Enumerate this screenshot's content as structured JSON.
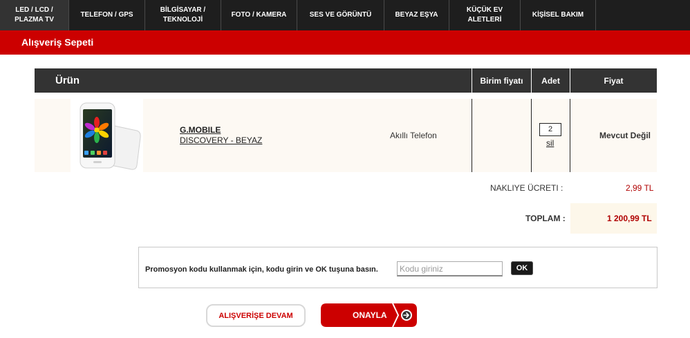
{
  "nav": {
    "items": [
      {
        "label": "LED / LCD /\nPLAZMA TV",
        "width": 100
      },
      {
        "label": "TELEFON / GPS",
        "width": 110
      },
      {
        "label": "BİLGİSAYAR /\nTEKNOLOJİ",
        "width": 110
      },
      {
        "label": "FOTO / KAMERA",
        "width": 110
      },
      {
        "label": "SES VE GÖRÜNTÜ",
        "width": 126
      },
      {
        "label": "BEYAZ EŞYA",
        "width": 94
      },
      {
        "label": "KÜÇÜK EV\nALETLERİ",
        "width": 103
      },
      {
        "label": "KİŞİSEL BAKIM",
        "width": 109
      }
    ]
  },
  "page": {
    "title": "Alışveriş Sepeti"
  },
  "cart": {
    "headers": {
      "product": "Ürün",
      "unit_price": "Birim fiyatı",
      "quantity": "Adet",
      "price": "Fiyat"
    },
    "items": [
      {
        "brand": "G.MOBILE",
        "model": "DISCOVERY - BEYAZ",
        "category": "Akıllı Telefon",
        "quantity": "2",
        "remove_label": "sil",
        "price": "Mevcut Değil"
      }
    ],
    "shipping_label": "NAKLIYE ÜCRETI :",
    "shipping_value": "2,99 TL",
    "total_label": "TOPLAM :",
    "total_value": "1 200,99 TL"
  },
  "promo": {
    "text": "Promosyon kodu kullanmak için, kodu girin ve OK tuşuna basın.",
    "placeholder": "Kodu giriniz",
    "ok_label": "OK"
  },
  "buttons": {
    "continue_label": "ALIŞVERİŞE DEVAM",
    "approve_label": "ONAYLA"
  },
  "colors": {
    "nav_bg": "#1e1e1e",
    "accent": "#cc0000",
    "header_bg": "#333333",
    "row_bg": "#fdf9f3",
    "price_red": "#b00000"
  },
  "icons": {
    "approve": "arrow-right-circle-icon"
  }
}
